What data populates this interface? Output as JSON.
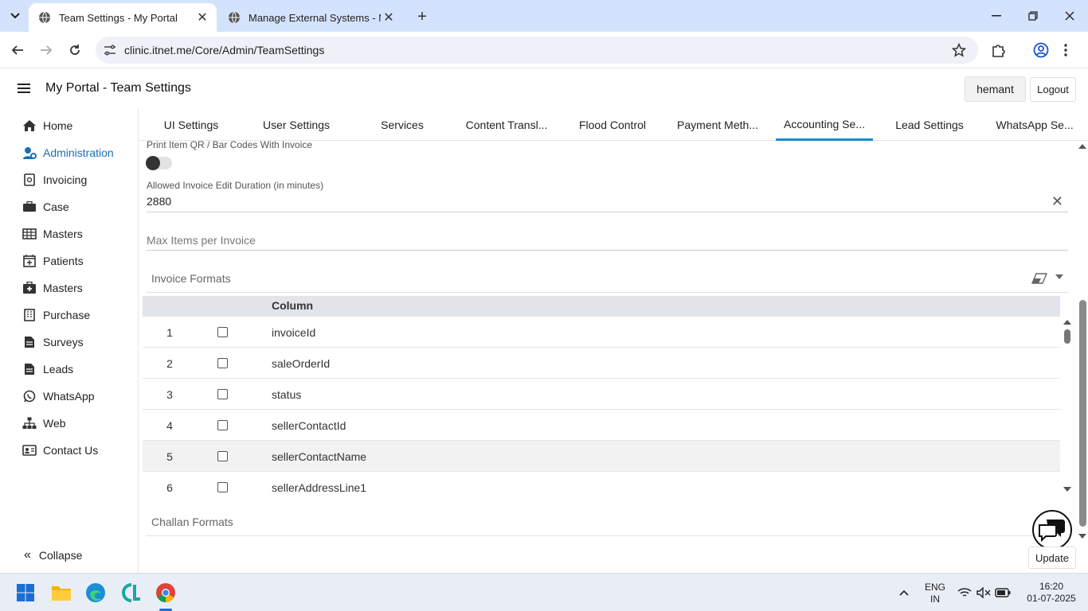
{
  "browser": {
    "tabs": [
      {
        "title": "Team Settings - My Portal",
        "active": true
      },
      {
        "title": "Manage External Systems - My",
        "active": false
      }
    ],
    "url": "clinic.itnet.me/Core/Admin/TeamSettings"
  },
  "header": {
    "title": "My Portal  - Team Settings",
    "user": "hemant",
    "logout": "Logout"
  },
  "sidebar": {
    "items": [
      {
        "label": "Home",
        "icon": "home-icon"
      },
      {
        "label": "Administration",
        "icon": "admin-icon",
        "active": true
      },
      {
        "label": "Invoicing",
        "icon": "invoice-icon"
      },
      {
        "label": "Case",
        "icon": "briefcase-icon"
      },
      {
        "label": "Masters",
        "icon": "table-icon"
      },
      {
        "label": "Patients",
        "icon": "calendar-plus-icon"
      },
      {
        "label": "Masters",
        "icon": "medical-bag-icon"
      },
      {
        "label": "Purchase",
        "icon": "building-icon"
      },
      {
        "label": "Surveys",
        "icon": "document-icon"
      },
      {
        "label": "Leads",
        "icon": "document-icon"
      },
      {
        "label": "WhatsApp",
        "icon": "whatsapp-icon"
      },
      {
        "label": "Web",
        "icon": "sitemap-icon"
      },
      {
        "label": "Contact Us",
        "icon": "contact-card-icon"
      }
    ],
    "collapse": "Collapse"
  },
  "tabs": [
    {
      "label": "UI Settings"
    },
    {
      "label": "User Settings"
    },
    {
      "label": "Services"
    },
    {
      "label": "Content Transl..."
    },
    {
      "label": "Flood Control"
    },
    {
      "label": "Payment Meth..."
    },
    {
      "label": "Accounting Se...",
      "active": true
    },
    {
      "label": "Lead Settings"
    },
    {
      "label": "WhatsApp Se..."
    }
  ],
  "form": {
    "print_qr_label": "Print Item QR / Bar Codes With Invoice",
    "edit_duration_label": "Allowed Invoice Edit Duration (in minutes)",
    "edit_duration_value": "2880",
    "max_items_placeholder": "Max Items per Invoice",
    "invoice_formats_label": "Invoice Formats",
    "challan_formats_label": "Challan Formats",
    "grid_column_header": "Column",
    "rows": [
      {
        "num": "1",
        "name": "invoiceId"
      },
      {
        "num": "2",
        "name": "saleOrderId"
      },
      {
        "num": "3",
        "name": "status"
      },
      {
        "num": "4",
        "name": "sellerContactId"
      },
      {
        "num": "5",
        "name": "sellerContactName"
      },
      {
        "num": "6",
        "name": "sellerAddressLine1"
      }
    ]
  },
  "update": "Update",
  "taskbar": {
    "lang_top": "ENG",
    "lang_bottom": "IN",
    "time": "16:20",
    "date": "01-07-2025"
  }
}
